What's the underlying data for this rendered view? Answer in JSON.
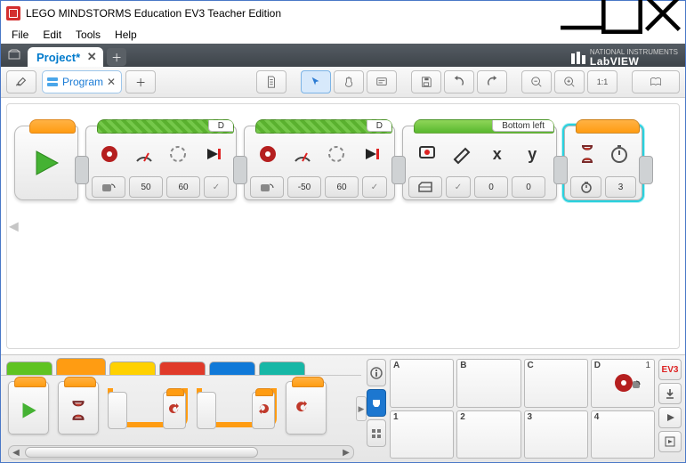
{
  "title": "LEGO MINDSTORMS Education EV3 Teacher Edition",
  "menus": {
    "file": "File",
    "edit": "Edit",
    "tools": "Tools",
    "help": "Help"
  },
  "project_tab": {
    "label": "Project*"
  },
  "program_tab": {
    "label": "Program"
  },
  "brand": {
    "company": "NATIONAL INSTRUMENTS",
    "product": "LabVIEW"
  },
  "blocks": {
    "move1": {
      "port": "D",
      "power": "50",
      "rotations": "60"
    },
    "move2": {
      "port": "D",
      "power": "-50",
      "rotations": "60"
    },
    "display": {
      "label": "Bottom left",
      "x": "0",
      "y": "0",
      "letters": {
        "x": "x",
        "y": "y"
      }
    },
    "wait": {
      "seconds": "3"
    }
  },
  "ports": {
    "top": [
      {
        "label": "A"
      },
      {
        "label": "B"
      },
      {
        "label": "C"
      },
      {
        "label": "D",
        "value": "1",
        "motor": true
      }
    ],
    "bottom": [
      {
        "label": "1"
      },
      {
        "label": "2"
      },
      {
        "label": "3"
      },
      {
        "label": "4"
      }
    ]
  },
  "ev3_label": "EV3"
}
